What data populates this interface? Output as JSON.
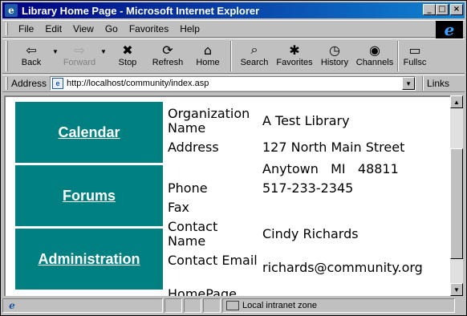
{
  "window": {
    "title": "Library Home Page - Microsoft Internet Explorer",
    "min_glyph": "_",
    "max_glyph": "□",
    "close_glyph": "×",
    "logo_glyph": "e"
  },
  "menu": {
    "items": [
      "File",
      "Edit",
      "View",
      "Go",
      "Favorites",
      "Help"
    ]
  },
  "toolbar": {
    "buttons": [
      {
        "label": "Back",
        "icon": "⇦"
      },
      {
        "label": "Forward",
        "icon": "⇨"
      },
      {
        "label": "Stop",
        "icon": "✖"
      },
      {
        "label": "Refresh",
        "icon": "⟳"
      },
      {
        "label": "Home",
        "icon": "⌂"
      },
      {
        "label": "Search",
        "icon": "⌕"
      },
      {
        "label": "Favorites",
        "icon": "✱"
      },
      {
        "label": "History",
        "icon": "◷"
      },
      {
        "label": "Channels",
        "icon": "◉"
      },
      {
        "label": "Fullsc",
        "icon": "▭"
      }
    ],
    "drop_glyph": "▼"
  },
  "address": {
    "label": "Address",
    "url": "http://localhost/community/index.asp",
    "links_label": "Links",
    "drop_glyph": "▼"
  },
  "nav": {
    "links": [
      "Calendar",
      "Forums",
      "Administration"
    ]
  },
  "info": {
    "rows": [
      {
        "label": "Organization Name",
        "value": "A Test Library"
      },
      {
        "label": "Address",
        "value": "127 North Main Street"
      },
      {
        "label": "",
        "value": "Anytown   MI   48811"
      },
      {
        "label": "Phone",
        "value": "517-233-2345"
      },
      {
        "label": "Fax",
        "value": ""
      },
      {
        "label": "Contact Name",
        "value": "Cindy Richards"
      },
      {
        "label": "Contact Email",
        "value": "richards@community.org"
      },
      {
        "label": "HomePage",
        "value": ""
      }
    ]
  },
  "scrollbar": {
    "up_glyph": "▲",
    "down_glyph": "▼"
  },
  "status": {
    "zone": "Local intranet zone"
  },
  "colors": {
    "nav_bg": "#008080",
    "title_bar": "#000080"
  }
}
